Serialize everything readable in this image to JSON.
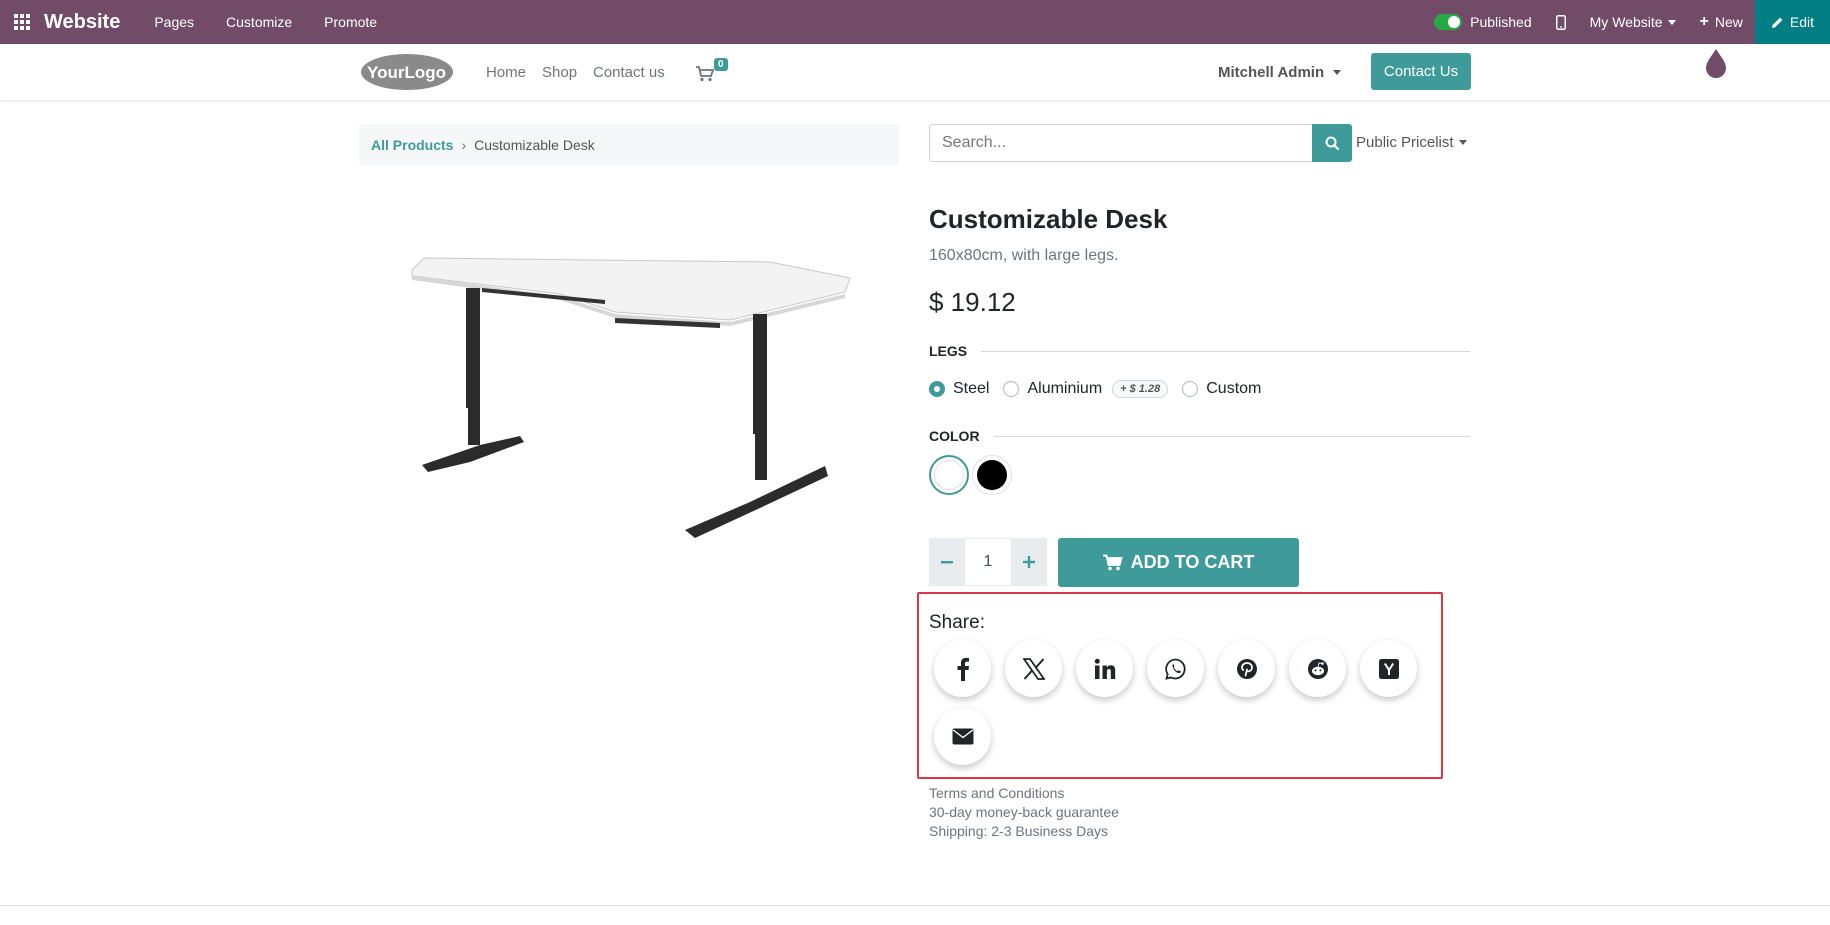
{
  "adminbar": {
    "brand": "Website",
    "menu": [
      "Pages",
      "Customize",
      "Promote"
    ],
    "published_label": "Published",
    "website_label": "My Website",
    "new_label": "New",
    "edit_label": "Edit",
    "color": "#714b67"
  },
  "header": {
    "logo_text": "YourLogo",
    "nav": [
      "Home",
      "Shop",
      "Contact us"
    ],
    "cart_count": "0",
    "user": "Mitchell Admin",
    "contact_button": "Contact Us"
  },
  "breadcrumb": {
    "parent": "All Products",
    "current": "Customizable Desk"
  },
  "search": {
    "placeholder": "Search...",
    "pricelist": "Public Pricelist"
  },
  "product": {
    "name": "Customizable Desk",
    "description": "160x80cm, with large legs.",
    "price": "$ 19.12",
    "legs_label": "LEGS",
    "legs_options": [
      {
        "label": "Steel",
        "checked": true
      },
      {
        "label": "Aluminium",
        "extra": "+ $ 1.28",
        "checked": false
      },
      {
        "label": "Custom",
        "checked": false
      }
    ],
    "color_label": "COLOR",
    "colors": [
      "#ffffff",
      "#000000"
    ],
    "quantity": "1",
    "add_to_cart": "ADD TO CART"
  },
  "share": {
    "label": "Share:",
    "icons": [
      "facebook-icon",
      "x-icon",
      "linkedin-icon",
      "whatsapp-icon",
      "pinterest-icon",
      "reddit-icon",
      "hacker-news-icon",
      "email-icon"
    ]
  },
  "info": {
    "terms": "Terms and Conditions",
    "guarantee": "30-day money-back guarantee",
    "shipping": "Shipping: 2-3 Business Days"
  },
  "accent_color": "#3f9a9a"
}
